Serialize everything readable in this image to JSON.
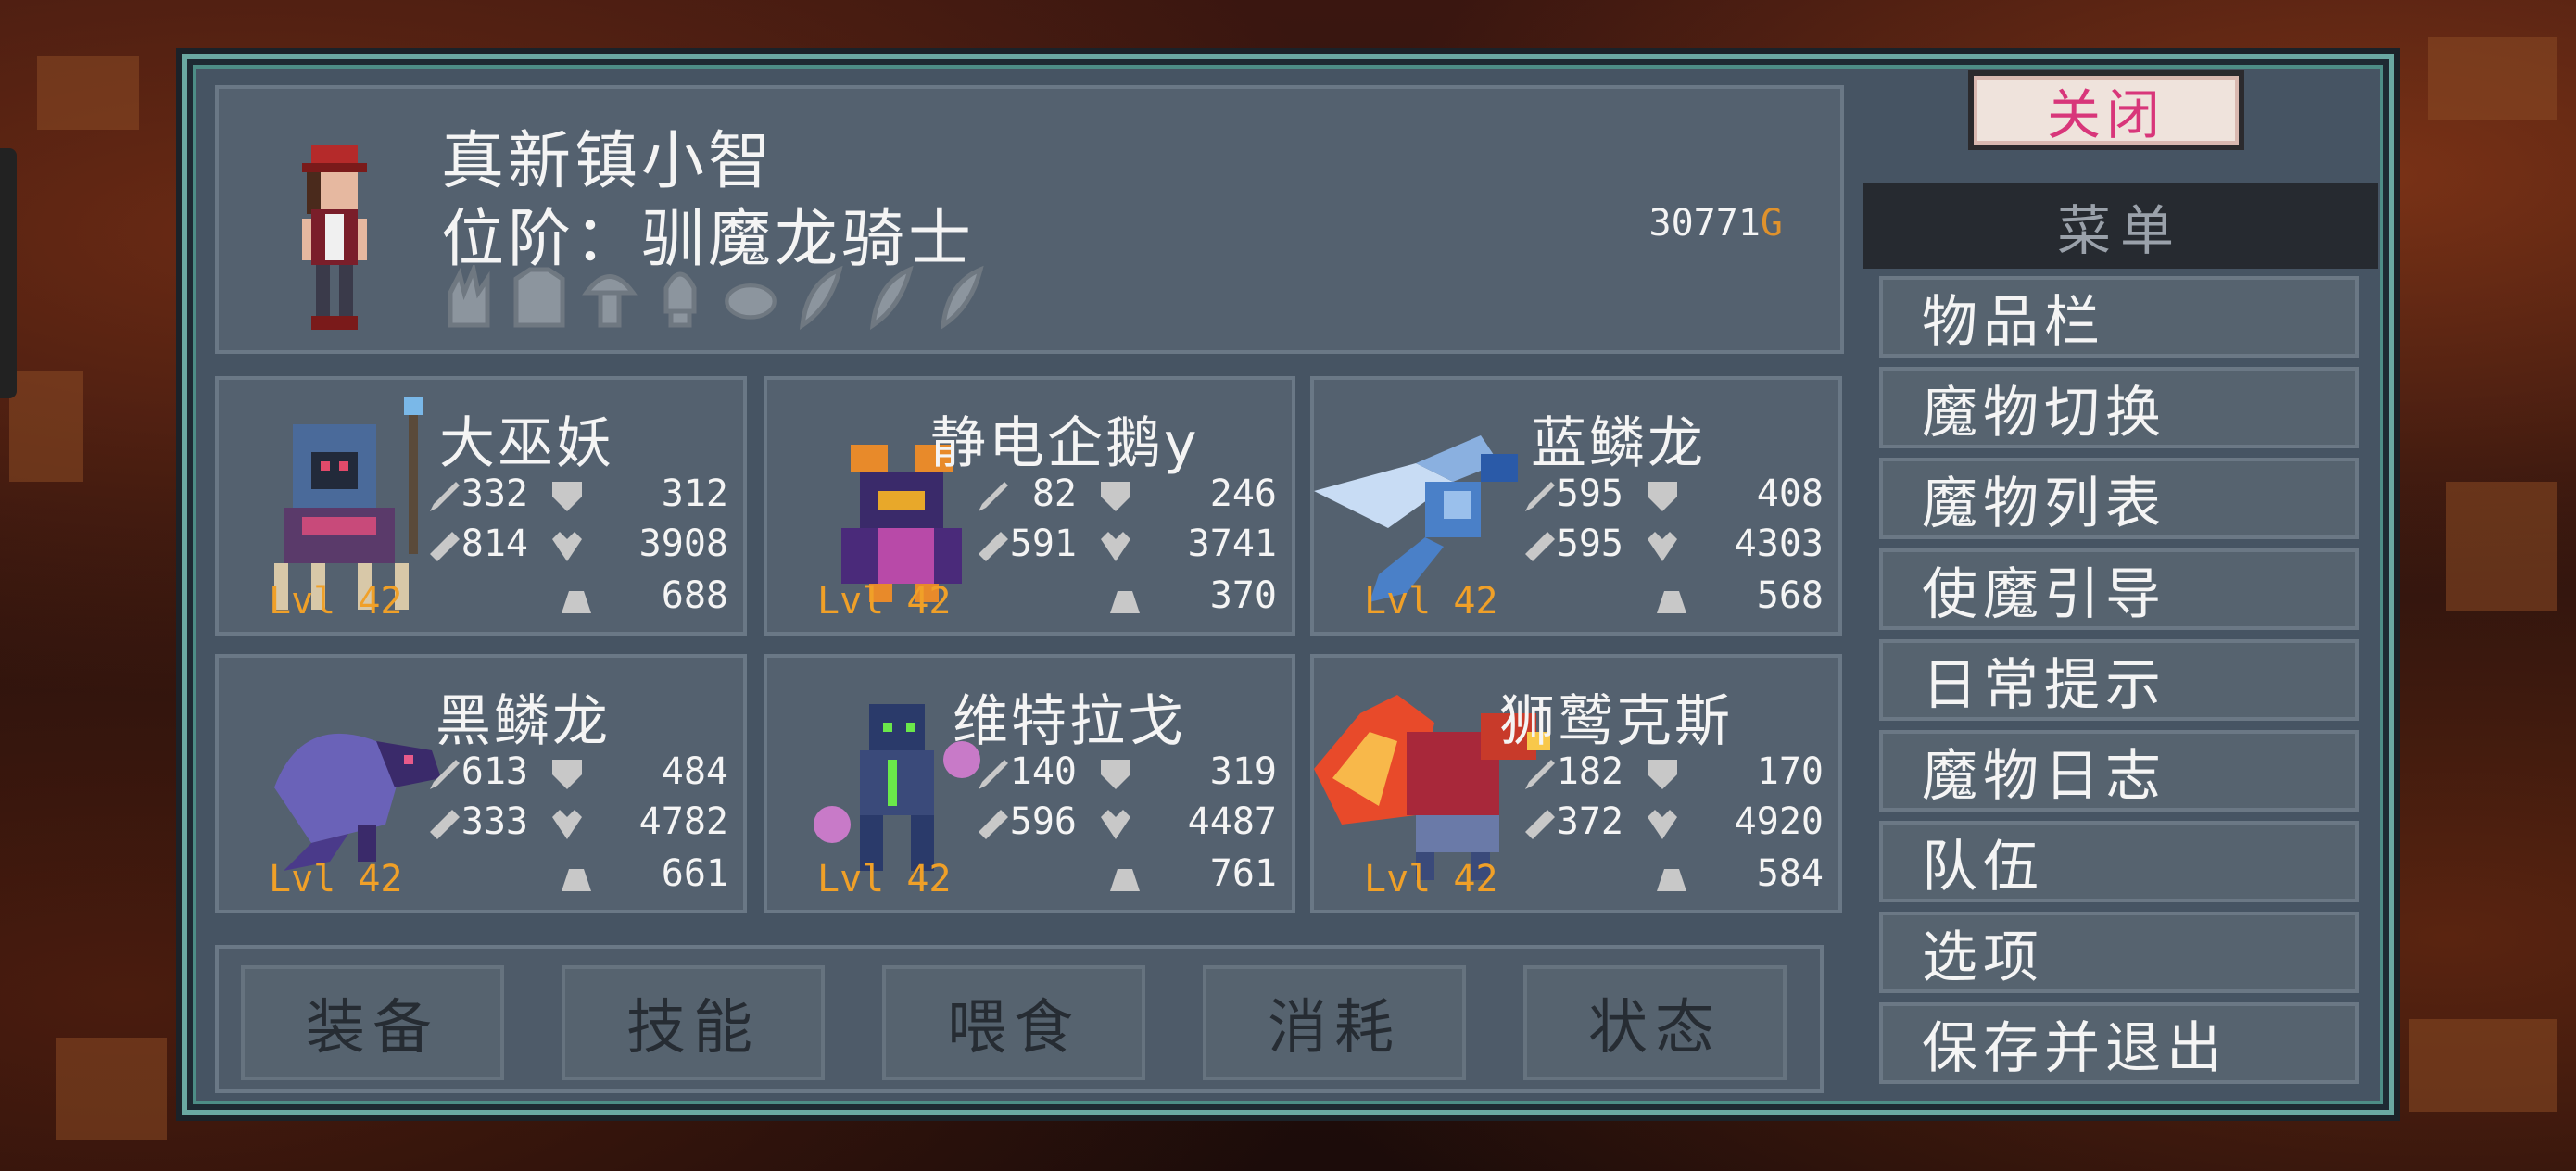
{
  "header": {
    "name": "真新镇小智",
    "rank": "位阶：驯魔龙骑士",
    "gold_amount": "30771",
    "gold_unit": "G",
    "badges": [
      "claw-badge-icon",
      "armor-badge-icon",
      "mushroom-badge-icon",
      "bulb-badge-icon",
      "stone-badge-icon",
      "feather-badge-icon",
      "feather-badge-icon",
      "feather-badge-icon"
    ]
  },
  "monsters": [
    {
      "name": "大巫妖",
      "atk": "332",
      "def": "312",
      "mag": "814",
      "hp": "3908",
      "mana": "688",
      "level": "Lvl 42"
    },
    {
      "name": "静电企鹅y",
      "atk": "82",
      "def": "246",
      "mag": "591",
      "hp": "3741",
      "mana": "370",
      "level": "Lvl 42"
    },
    {
      "name": "蓝鳞龙",
      "atk": "595",
      "def": "408",
      "mag": "595",
      "hp": "4303",
      "mana": "568",
      "level": "Lvl 42"
    },
    {
      "name": "黑鳞龙",
      "atk": "613",
      "def": "484",
      "mag": "333",
      "hp": "4782",
      "mana": "661",
      "level": "Lvl 42"
    },
    {
      "name": "维特拉戈",
      "atk": "140",
      "def": "319",
      "mag": "596",
      "hp": "4487",
      "mana": "761",
      "level": "Lvl 42"
    },
    {
      "name": "狮鹫克斯",
      "atk": "182",
      "def": "170",
      "mag": "372",
      "hp": "4920",
      "mana": "584",
      "level": "Lvl 42"
    }
  ],
  "actions": [
    "装备",
    "技能",
    "喂食",
    "消耗",
    "状态"
  ],
  "close_label": "关闭",
  "menu": {
    "title": "菜单",
    "items": [
      "物品栏",
      "魔物切换",
      "魔物列表",
      "使魔引导",
      "日常提示",
      "魔物日志",
      "队伍",
      "选项",
      "保存并退出"
    ]
  }
}
